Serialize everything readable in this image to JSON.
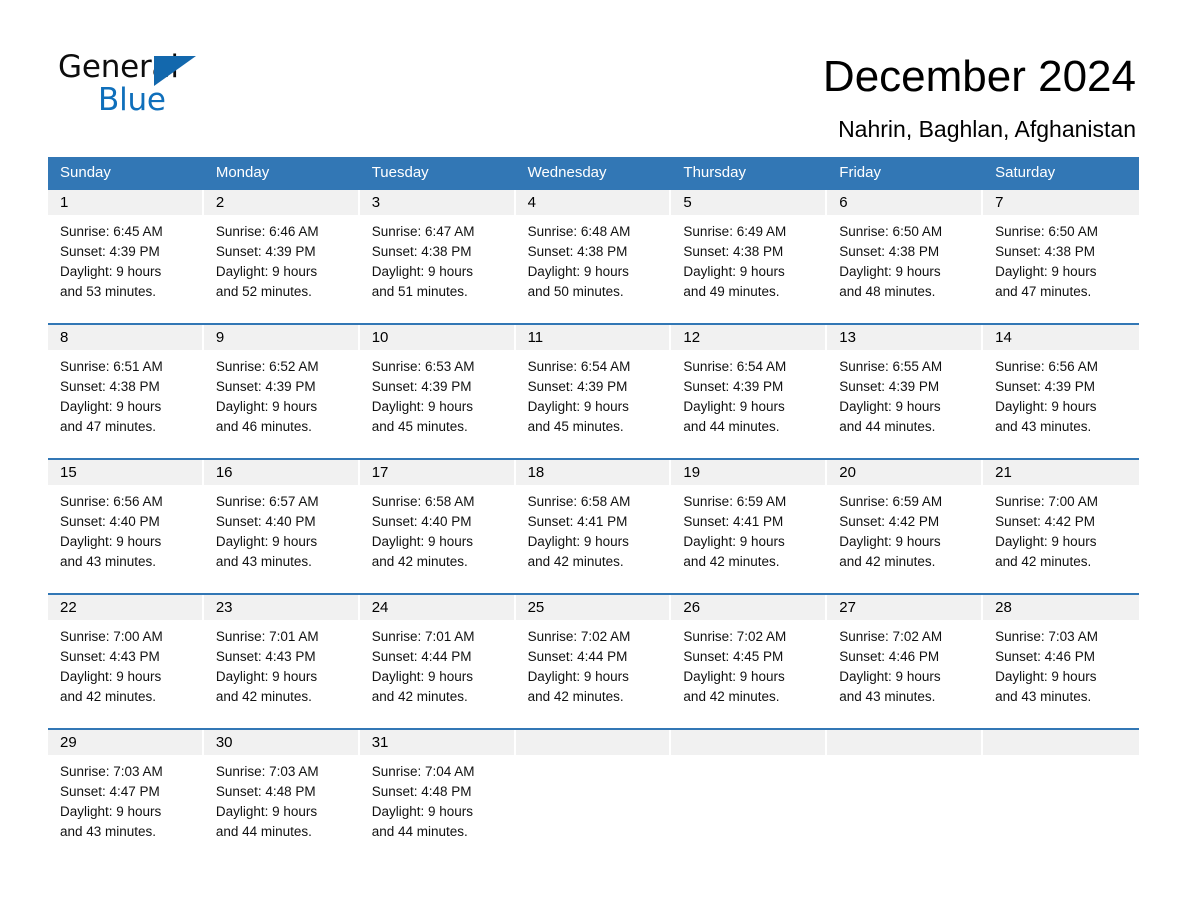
{
  "brand": {
    "name_part1": "General",
    "name_part2": "Blue",
    "triangle_icon": "triangle-icon",
    "accent_color": "#1368ad"
  },
  "header": {
    "month_title": "December 2024",
    "location": "Nahrin, Baghlan, Afghanistan"
  },
  "colors": {
    "header_blue": "#3277b5",
    "daynum_band": "#f1f1f1",
    "text": "#000000"
  },
  "weekday_headers": [
    "Sunday",
    "Monday",
    "Tuesday",
    "Wednesday",
    "Thursday",
    "Friday",
    "Saturday"
  ],
  "weeks": [
    {
      "days": [
        {
          "date": "1",
          "sunrise": "Sunrise: 6:45 AM",
          "sunset": "Sunset: 4:39 PM",
          "daylight_line1": "Daylight: 9 hours",
          "daylight_line2": "and 53 minutes."
        },
        {
          "date": "2",
          "sunrise": "Sunrise: 6:46 AM",
          "sunset": "Sunset: 4:39 PM",
          "daylight_line1": "Daylight: 9 hours",
          "daylight_line2": "and 52 minutes."
        },
        {
          "date": "3",
          "sunrise": "Sunrise: 6:47 AM",
          "sunset": "Sunset: 4:38 PM",
          "daylight_line1": "Daylight: 9 hours",
          "daylight_line2": "and 51 minutes."
        },
        {
          "date": "4",
          "sunrise": "Sunrise: 6:48 AM",
          "sunset": "Sunset: 4:38 PM",
          "daylight_line1": "Daylight: 9 hours",
          "daylight_line2": "and 50 minutes."
        },
        {
          "date": "5",
          "sunrise": "Sunrise: 6:49 AM",
          "sunset": "Sunset: 4:38 PM",
          "daylight_line1": "Daylight: 9 hours",
          "daylight_line2": "and 49 minutes."
        },
        {
          "date": "6",
          "sunrise": "Sunrise: 6:50 AM",
          "sunset": "Sunset: 4:38 PM",
          "daylight_line1": "Daylight: 9 hours",
          "daylight_line2": "and 48 minutes."
        },
        {
          "date": "7",
          "sunrise": "Sunrise: 6:50 AM",
          "sunset": "Sunset: 4:38 PM",
          "daylight_line1": "Daylight: 9 hours",
          "daylight_line2": "and 47 minutes."
        }
      ]
    },
    {
      "days": [
        {
          "date": "8",
          "sunrise": "Sunrise: 6:51 AM",
          "sunset": "Sunset: 4:38 PM",
          "daylight_line1": "Daylight: 9 hours",
          "daylight_line2": "and 47 minutes."
        },
        {
          "date": "9",
          "sunrise": "Sunrise: 6:52 AM",
          "sunset": "Sunset: 4:39 PM",
          "daylight_line1": "Daylight: 9 hours",
          "daylight_line2": "and 46 minutes."
        },
        {
          "date": "10",
          "sunrise": "Sunrise: 6:53 AM",
          "sunset": "Sunset: 4:39 PM",
          "daylight_line1": "Daylight: 9 hours",
          "daylight_line2": "and 45 minutes."
        },
        {
          "date": "11",
          "sunrise": "Sunrise: 6:54 AM",
          "sunset": "Sunset: 4:39 PM",
          "daylight_line1": "Daylight: 9 hours",
          "daylight_line2": "and 45 minutes."
        },
        {
          "date": "12",
          "sunrise": "Sunrise: 6:54 AM",
          "sunset": "Sunset: 4:39 PM",
          "daylight_line1": "Daylight: 9 hours",
          "daylight_line2": "and 44 minutes."
        },
        {
          "date": "13",
          "sunrise": "Sunrise: 6:55 AM",
          "sunset": "Sunset: 4:39 PM",
          "daylight_line1": "Daylight: 9 hours",
          "daylight_line2": "and 44 minutes."
        },
        {
          "date": "14",
          "sunrise": "Sunrise: 6:56 AM",
          "sunset": "Sunset: 4:39 PM",
          "daylight_line1": "Daylight: 9 hours",
          "daylight_line2": "and 43 minutes."
        }
      ]
    },
    {
      "days": [
        {
          "date": "15",
          "sunrise": "Sunrise: 6:56 AM",
          "sunset": "Sunset: 4:40 PM",
          "daylight_line1": "Daylight: 9 hours",
          "daylight_line2": "and 43 minutes."
        },
        {
          "date": "16",
          "sunrise": "Sunrise: 6:57 AM",
          "sunset": "Sunset: 4:40 PM",
          "daylight_line1": "Daylight: 9 hours",
          "daylight_line2": "and 43 minutes."
        },
        {
          "date": "17",
          "sunrise": "Sunrise: 6:58 AM",
          "sunset": "Sunset: 4:40 PM",
          "daylight_line1": "Daylight: 9 hours",
          "daylight_line2": "and 42 minutes."
        },
        {
          "date": "18",
          "sunrise": "Sunrise: 6:58 AM",
          "sunset": "Sunset: 4:41 PM",
          "daylight_line1": "Daylight: 9 hours",
          "daylight_line2": "and 42 minutes."
        },
        {
          "date": "19",
          "sunrise": "Sunrise: 6:59 AM",
          "sunset": "Sunset: 4:41 PM",
          "daylight_line1": "Daylight: 9 hours",
          "daylight_line2": "and 42 minutes."
        },
        {
          "date": "20",
          "sunrise": "Sunrise: 6:59 AM",
          "sunset": "Sunset: 4:42 PM",
          "daylight_line1": "Daylight: 9 hours",
          "daylight_line2": "and 42 minutes."
        },
        {
          "date": "21",
          "sunrise": "Sunrise: 7:00 AM",
          "sunset": "Sunset: 4:42 PM",
          "daylight_line1": "Daylight: 9 hours",
          "daylight_line2": "and 42 minutes."
        }
      ]
    },
    {
      "days": [
        {
          "date": "22",
          "sunrise": "Sunrise: 7:00 AM",
          "sunset": "Sunset: 4:43 PM",
          "daylight_line1": "Daylight: 9 hours",
          "daylight_line2": "and 42 minutes."
        },
        {
          "date": "23",
          "sunrise": "Sunrise: 7:01 AM",
          "sunset": "Sunset: 4:43 PM",
          "daylight_line1": "Daylight: 9 hours",
          "daylight_line2": "and 42 minutes."
        },
        {
          "date": "24",
          "sunrise": "Sunrise: 7:01 AM",
          "sunset": "Sunset: 4:44 PM",
          "daylight_line1": "Daylight: 9 hours",
          "daylight_line2": "and 42 minutes."
        },
        {
          "date": "25",
          "sunrise": "Sunrise: 7:02 AM",
          "sunset": "Sunset: 4:44 PM",
          "daylight_line1": "Daylight: 9 hours",
          "daylight_line2": "and 42 minutes."
        },
        {
          "date": "26",
          "sunrise": "Sunrise: 7:02 AM",
          "sunset": "Sunset: 4:45 PM",
          "daylight_line1": "Daylight: 9 hours",
          "daylight_line2": "and 42 minutes."
        },
        {
          "date": "27",
          "sunrise": "Sunrise: 7:02 AM",
          "sunset": "Sunset: 4:46 PM",
          "daylight_line1": "Daylight: 9 hours",
          "daylight_line2": "and 43 minutes."
        },
        {
          "date": "28",
          "sunrise": "Sunrise: 7:03 AM",
          "sunset": "Sunset: 4:46 PM",
          "daylight_line1": "Daylight: 9 hours",
          "daylight_line2": "and 43 minutes."
        }
      ]
    },
    {
      "days": [
        {
          "date": "29",
          "sunrise": "Sunrise: 7:03 AM",
          "sunset": "Sunset: 4:47 PM",
          "daylight_line1": "Daylight: 9 hours",
          "daylight_line2": "and 43 minutes."
        },
        {
          "date": "30",
          "sunrise": "Sunrise: 7:03 AM",
          "sunset": "Sunset: 4:48 PM",
          "daylight_line1": "Daylight: 9 hours",
          "daylight_line2": "and 44 minutes."
        },
        {
          "date": "31",
          "sunrise": "Sunrise: 7:04 AM",
          "sunset": "Sunset: 4:48 PM",
          "daylight_line1": "Daylight: 9 hours",
          "daylight_line2": "and 44 minutes."
        },
        {
          "date": "",
          "sunrise": "",
          "sunset": "",
          "daylight_line1": "",
          "daylight_line2": ""
        },
        {
          "date": "",
          "sunrise": "",
          "sunset": "",
          "daylight_line1": "",
          "daylight_line2": ""
        },
        {
          "date": "",
          "sunrise": "",
          "sunset": "",
          "daylight_line1": "",
          "daylight_line2": ""
        },
        {
          "date": "",
          "sunrise": "",
          "sunset": "",
          "daylight_line1": "",
          "daylight_line2": ""
        }
      ]
    }
  ]
}
